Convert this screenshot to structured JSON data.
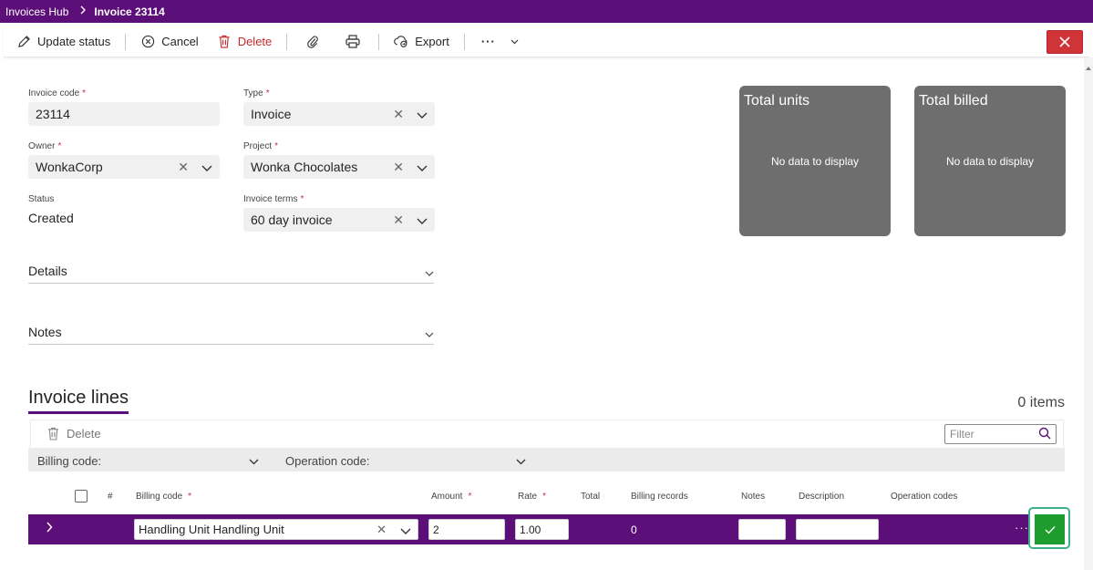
{
  "breadcrumb": {
    "app": "Invoices Hub",
    "current": "Invoice 23114"
  },
  "toolbar": {
    "update_status": "Update status",
    "cancel": "Cancel",
    "delete": "Delete",
    "export": "Export",
    "more": "···"
  },
  "form": {
    "invoice_code_label": "Invoice code",
    "invoice_code_value": "23114",
    "type_label": "Type",
    "type_value": "Invoice",
    "owner_label": "Owner",
    "owner_value": "WonkaCorp",
    "project_label": "Project",
    "project_value": "Wonka Chocolates",
    "status_label": "Status",
    "status_value": "Created",
    "invoice_terms_label": "Invoice terms",
    "invoice_terms_value": "60 day invoice",
    "required_mark": "*",
    "clear_glyph": "✕"
  },
  "sections": {
    "details": "Details",
    "notes": "Notes"
  },
  "tiles": {
    "total_units": {
      "title": "Total units",
      "empty": "No data to display"
    },
    "total_billed": {
      "title": "Total billed",
      "empty": "No data to display"
    }
  },
  "lines": {
    "title": "Invoice lines",
    "count": "0 items",
    "delete": "Delete",
    "filter_placeholder": "Filter",
    "group_billing": "Billing code:",
    "group_operation": "Operation code:",
    "columns": {
      "num": "#",
      "billing_code": "Billing code",
      "amount": "Amount",
      "rate": "Rate",
      "total": "Total",
      "billing_records": "Billing records",
      "notes": "Notes",
      "description": "Description",
      "operation_codes": "Operation codes"
    },
    "row": {
      "billing_code": "Handling Unit Handling Unit",
      "amount": "2",
      "rate": "1.00",
      "billing_records": "0",
      "notes": "",
      "description": "",
      "more": "···"
    }
  },
  "colors": {
    "brand": "#5c0f78",
    "danger": "#d13438",
    "tile": "#6e6e6e",
    "save": "#1e9c2e"
  }
}
